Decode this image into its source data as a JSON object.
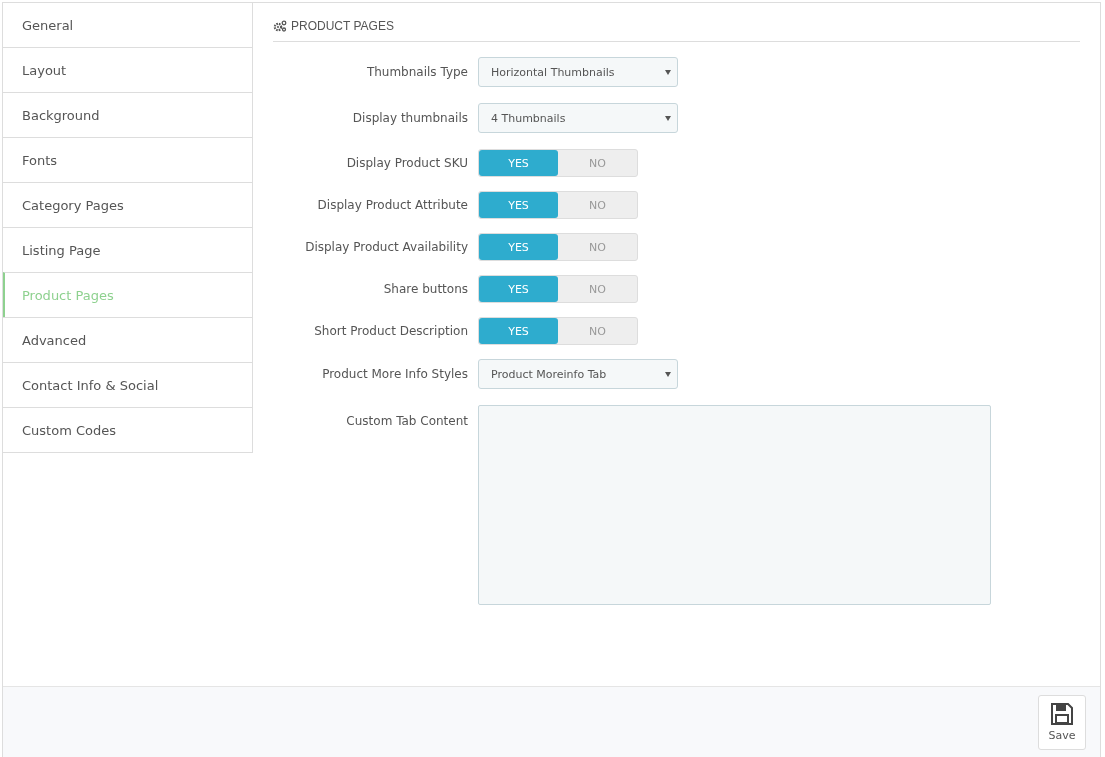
{
  "sidebar": {
    "items": [
      {
        "label": "General",
        "selected": false
      },
      {
        "label": "Layout",
        "selected": false
      },
      {
        "label": "Background",
        "selected": false
      },
      {
        "label": "Fonts",
        "selected": false
      },
      {
        "label": "Category Pages",
        "selected": false
      },
      {
        "label": "Listing Page",
        "selected": false
      },
      {
        "label": "Product Pages",
        "selected": true
      },
      {
        "label": "Advanced",
        "selected": false
      },
      {
        "label": "Contact Info & Social",
        "selected": false
      },
      {
        "label": "Custom Codes",
        "selected": false
      }
    ]
  },
  "panel": {
    "title": "PRODUCT PAGES",
    "fields": [
      {
        "kind": "select",
        "label": "Thumbnails Type",
        "value": "Horizontal Thumbnails"
      },
      {
        "kind": "select",
        "label": "Display thumbnails",
        "value": "4 Thumbnails"
      },
      {
        "kind": "toggle",
        "label": "Display Product SKU",
        "yes": "YES",
        "no": "NO",
        "on": true
      },
      {
        "kind": "toggle",
        "label": "Display Product Attribute",
        "yes": "YES",
        "no": "NO",
        "on": true
      },
      {
        "kind": "toggle",
        "label": "Display Product Availability",
        "yes": "YES",
        "no": "NO",
        "on": true
      },
      {
        "kind": "toggle",
        "label": "Share buttons",
        "yes": "YES",
        "no": "NO",
        "on": true
      },
      {
        "kind": "toggle",
        "label": "Short Product Description",
        "yes": "YES",
        "no": "NO",
        "on": true
      },
      {
        "kind": "select",
        "label": "Product More Info Styles",
        "value": "Product Moreinfo Tab"
      },
      {
        "kind": "textarea",
        "label": "Custom Tab Content"
      }
    ]
  },
  "footer": {
    "save": "Save"
  }
}
